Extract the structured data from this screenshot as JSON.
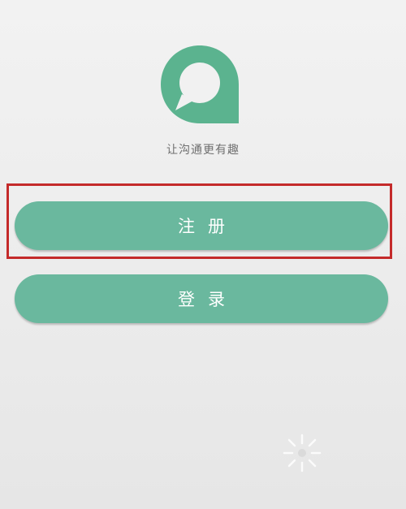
{
  "brand": {
    "logo_icon": "speech-bubble-q-logo",
    "accent_color": "#6ab89e",
    "slogan": "让沟通更有趣"
  },
  "actions": {
    "register_label": "注册",
    "login_label": "登录"
  },
  "highlight": {
    "color": "#c42a2a",
    "target": "register-button"
  },
  "loading": {
    "icon": "loading-spinner-icon"
  }
}
